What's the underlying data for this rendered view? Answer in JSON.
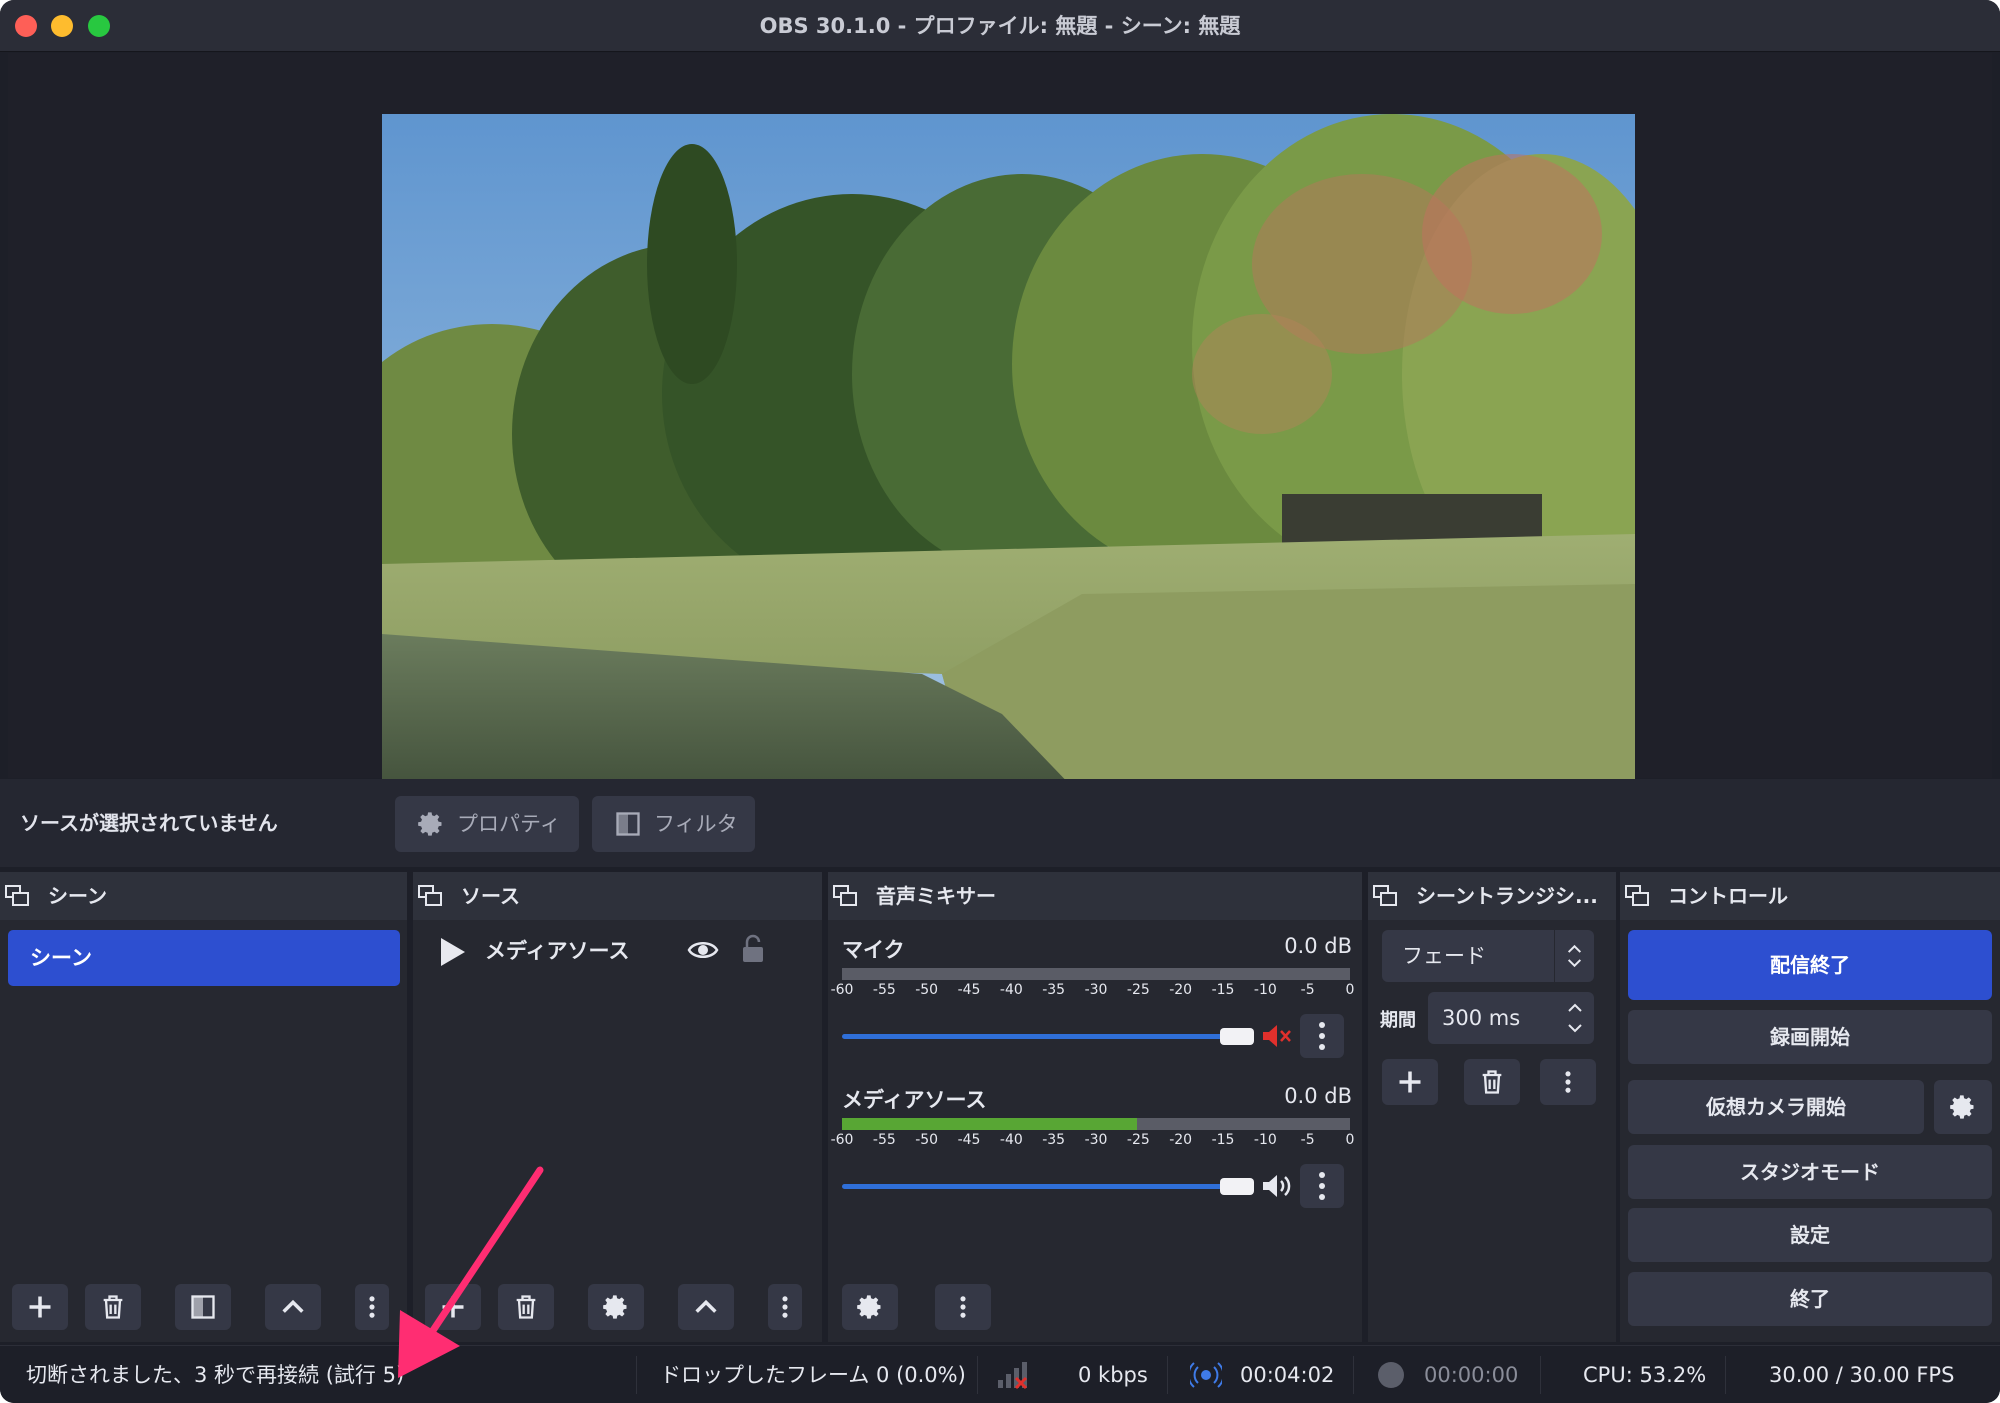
{
  "window": {
    "title": "OBS 30.1.0 - プロファイル: 無題 - シーン: 無題"
  },
  "source_toolbar": {
    "no_source_label": "ソースが選択されていません",
    "properties_label": "プロパティ",
    "filters_label": "フィルタ"
  },
  "docks": {
    "scenes": {
      "title": "シーン",
      "items": [
        {
          "label": "シーン",
          "selected": true
        }
      ]
    },
    "sources": {
      "title": "ソース",
      "items": [
        {
          "label": "メディアソース",
          "visible": true,
          "locked": false
        }
      ]
    },
    "audio_mixer": {
      "title": "音声ミキサー",
      "tick_labels": [
        "-60",
        "-55",
        "-50",
        "-45",
        "-40",
        "-35",
        "-30",
        "-25",
        "-20",
        "-15",
        "-10",
        "-5",
        "0"
      ],
      "channels": [
        {
          "name": "マイク",
          "level": "0.0 dB",
          "muted": true,
          "meter_fraction": 0.0,
          "volume_fraction": 1.0
        },
        {
          "name": "メディアソース",
          "level": "0.0 dB",
          "muted": false,
          "meter_fraction": 0.58,
          "volume_fraction": 1.0
        }
      ]
    },
    "transitions": {
      "title": "シーントランジシ...",
      "selected": "フェード",
      "duration_label": "期間",
      "duration_value": "300 ms"
    },
    "controls": {
      "title": "コントロール",
      "stop_streaming": "配信終了",
      "start_recording": "録画開始",
      "start_virtual_cam": "仮想カメラ開始",
      "studio_mode": "スタジオモード",
      "settings": "設定",
      "exit": "終了"
    }
  },
  "status_bar": {
    "connection": "切断されました、3 秒で再接続 (試行 5)",
    "dropped_frames": "ドロップしたフレーム 0 (0.0%)",
    "bitrate": "0 kbps",
    "stream_time": "00:04:02",
    "record_time": "00:00:00",
    "cpu": "CPU: 53.2%",
    "fps": "30.00 / 30.00 FPS"
  },
  "colors": {
    "accent": "#2d4fd0",
    "background": "#1d1f28",
    "panel": "#262830",
    "button": "#353846",
    "annotation_arrow": "#ff2d72",
    "meter_green": "#58a634",
    "mute_red": "#e0302c"
  },
  "icons": [
    "dock-icon",
    "gear-icon",
    "filter-icon",
    "play-icon",
    "eye-icon",
    "lock-icon",
    "plus-icon",
    "trash-icon",
    "filter-icon",
    "chevron-up-icon",
    "more-icon",
    "speaker-muted-icon",
    "speaker-icon",
    "network-icon",
    "stream-icon",
    "record-icon"
  ]
}
